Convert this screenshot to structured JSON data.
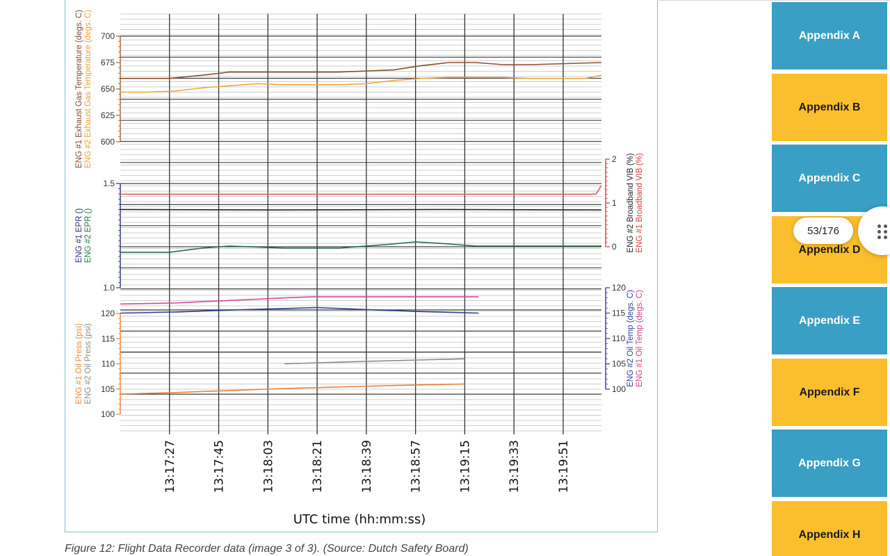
{
  "caption": "Figure 12: Flight Data Recorder data (image 3 of 3). (Source: Dutch Safety Board)",
  "pager": {
    "current": "53/176"
  },
  "appendix_nav": [
    {
      "label": "Appendix A",
      "color": "#3a9fc4"
    },
    {
      "label": "Appendix B",
      "color": "#fbbf2e"
    },
    {
      "label": "Appendix C",
      "color": "#3a9fc4"
    },
    {
      "label": "Appendix D",
      "color": "#fbbf2e"
    },
    {
      "label": "Appendix E",
      "color": "#3a9fc4"
    },
    {
      "label": "Appendix F",
      "color": "#fbbf2e"
    },
    {
      "label": "Appendix G",
      "color": "#3a9fc4"
    },
    {
      "label": "Appendix H",
      "color": "#fbbf2e"
    }
  ],
  "drag_icon": "drag-handle-icon",
  "chart_data": {
    "type": "line",
    "xlabel": "UTC time (hh:mm:ss)",
    "x_ticks": [
      "13:17:27",
      "13:17:45",
      "13:18:03",
      "13:18:21",
      "13:18:39",
      "13:18:57",
      "13:19:15",
      "13:19:33",
      "13:19:51"
    ],
    "x_tick_seconds": [
      18,
      36,
      54,
      72,
      90,
      108,
      126,
      144,
      162
    ],
    "x_range": [
      0,
      176
    ],
    "grid": true,
    "panels": [
      {
        "name": "egt",
        "ylim": [
          600,
          700
        ],
        "yticks": [
          600,
          625,
          650,
          675,
          700
        ],
        "left_labels": [
          {
            "text": "ENG #1 Exhaust Gas Temperature (degs. C)",
            "color": "#7a4a2e"
          },
          {
            "text": "ENG #2 Exhaust Gas Temperature (degs. C)",
            "color": "#e8a13a"
          }
        ],
        "left_axis_color": "#a0622e",
        "series": [
          {
            "name": "ENG #1 Exhaust Gas Temperature",
            "color": "#8a4f2e",
            "axis": "left",
            "x": [
              0,
              18,
              30,
              40,
              60,
              80,
              100,
              110,
              120,
              130,
              140,
              150,
              176
            ],
            "y": [
              660,
              660,
              663,
              666,
              666,
              666,
              668,
              672,
              675,
              675,
              673,
              673,
              675
            ]
          },
          {
            "name": "ENG #2 Exhaust Gas Temperature",
            "color": "#f0a640",
            "axis": "left",
            "x": [
              0,
              10,
              20,
              30,
              40,
              50,
              60,
              70,
              80,
              90,
              100,
              110,
              120,
              130,
              140,
              150,
              160,
              170,
              176
            ],
            "y": [
              647,
              647,
              648,
              651,
              653,
              655,
              654,
              654,
              654,
              655,
              658,
              660,
              661,
              661,
              661,
              660,
              660,
              660,
              663
            ]
          }
        ]
      },
      {
        "name": "epr_vib",
        "ylim": [
          1.0,
          1.5
        ],
        "yticks": [
          1.0,
          1.5
        ],
        "ytick_labels": [
          "1.0",
          "1.5"
        ],
        "left_labels": [
          {
            "text": "ENG #1 EPR ()",
            "color": "#2b2f7a"
          },
          {
            "text": "ENG #2 EPR ()",
            "color": "#1f7a45"
          }
        ],
        "left_axis_color": "#2b2f7a",
        "right_ylim": [
          0,
          2
        ],
        "right_yticks": [
          0,
          1,
          2
        ],
        "right_labels": [
          {
            "text": "ENG #2 Broadband VIB (%)",
            "color": "#222222"
          },
          {
            "text": "ENG #1 Broadband VIB (%)",
            "color": "#d43a3a"
          }
        ],
        "right_axis_color": "#d43a3a",
        "series": [
          {
            "name": "ENG #1 Broadband VIB",
            "color": "#d86060",
            "axis": "right",
            "x": [
              0,
              60,
              120,
              174,
              176
            ],
            "y": [
              1.2,
              1.2,
              1.2,
              1.2,
              1.4
            ]
          },
          {
            "name": "ENG #2 Broadband VIB",
            "color": "#222222",
            "axis": "right",
            "x": [
              0,
              60,
              120,
              176
            ],
            "y": [
              0.85,
              0.84,
              0.85,
              0.84
            ]
          },
          {
            "name": "ENG #2 EPR",
            "color": "#1f6a45",
            "axis": "left",
            "x": [
              0,
              18,
              30,
              40,
              60,
              80,
              90,
              100,
              108,
              120,
              130,
              140,
              150,
              160,
              176
            ],
            "y": [
              1.17,
              1.17,
              1.19,
              1.2,
              1.19,
              1.19,
              1.2,
              1.21,
              1.22,
              1.21,
              1.2,
              1.2,
              1.2,
              1.2,
              1.2
            ]
          }
        ]
      },
      {
        "name": "oil",
        "ylim": [
          100,
          120
        ],
        "yticks": [
          100,
          105,
          110,
          115,
          120
        ],
        "left_labels": [
          {
            "text": "ENG #1 Oil Press (psi)",
            "color": "#e88a3a"
          },
          {
            "text": "ENG #2 Oil Press (psi)",
            "color": "#8a8a8a"
          }
        ],
        "left_axis_color": "#e8833a",
        "right_ylim": [
          100,
          120
        ],
        "right_yticks": [
          100,
          105,
          110,
          115,
          120
        ],
        "right_labels": [
          {
            "text": "ENG #2 Oil Temp (degs. C)",
            "color": "#2b3f9a"
          },
          {
            "text": "ENG #1 Oil Temp (degs. C)",
            "color": "#d43a8a"
          }
        ],
        "right_axis_color": "#2b3f9a",
        "series": [
          {
            "name": "ENG #1 Oil Temp",
            "color": "#d44a9a",
            "axis": "right",
            "x": [
              0,
              20,
              40,
              60,
              70,
              80,
              100,
              131
            ],
            "y": [
              116.8,
              117,
              117.5,
              118,
              118.2,
              118.2,
              118.2,
              118.2
            ]
          },
          {
            "name": "ENG #2 Oil Temp",
            "color": "#2b3f8a",
            "axis": "right",
            "x": [
              0,
              20,
              40,
              60,
              72,
              90,
              110,
              131
            ],
            "y": [
              115,
              115.2,
              115.6,
              115.9,
              116.1,
              115.7,
              115.3,
              115
            ]
          },
          {
            "name": "ENG #2 Oil Press",
            "color": "#8a8a8a",
            "axis": "left",
            "x": [
              60,
              90,
              126
            ],
            "y": [
              110,
              110.5,
              111
            ]
          },
          {
            "name": "ENG #1 Oil Press",
            "color": "#e8833a",
            "axis": "left",
            "x": [
              0,
              20,
              40,
              60,
              80,
              100,
              126
            ],
            "y": [
              104,
              104.3,
              104.7,
              105.1,
              105.4,
              105.7,
              106
            ]
          }
        ]
      }
    ]
  }
}
